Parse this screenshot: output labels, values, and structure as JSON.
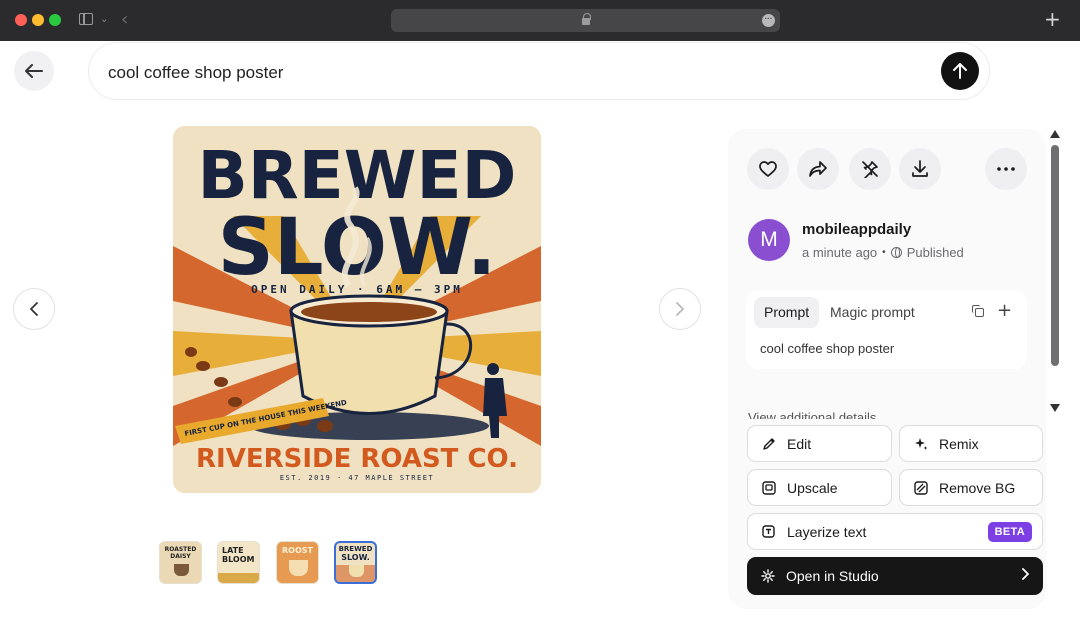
{
  "browser": {
    "icons": [
      "sidebar-icon",
      "chevron-down-icon",
      "back-icon",
      "lock-icon",
      "more-icon",
      "new-tab-icon"
    ]
  },
  "search": {
    "query": "cool coffee shop poster"
  },
  "poster": {
    "headline_1": "BREWED",
    "headline_2": "SLOW.",
    "hours": "OPEN DAILY · 6AM — 3PM",
    "banner": "FIRST CUP ON THE HOUSE THIS WEEKEND",
    "brand": "RIVERSIDE ROAST CO.",
    "footer": "EST. 2019 · 47 MAPLE STREET",
    "colors": {
      "navy": "#17233f",
      "orange": "#d25a1e",
      "cream": "#efe1c2",
      "gold": "#e8a92c"
    }
  },
  "thumbnails": [
    {
      "label_1": "ROASTED",
      "label_2": "DAISY",
      "active": false
    },
    {
      "label_1": "LATE",
      "label_2": "BLOOM",
      "active": false
    },
    {
      "label_1": "ROOST",
      "label_2": "",
      "active": false
    },
    {
      "label_1": "BREWED",
      "label_2": "SLOW.",
      "active": true
    }
  ],
  "actions_top": [
    "heart-icon",
    "share-icon",
    "unpin-icon",
    "download-icon",
    "more-icon"
  ],
  "author": {
    "initial": "M",
    "name": "mobileappdaily",
    "time": "a minute ago",
    "separator": "•",
    "visibility": "Published",
    "avatar_color": "#8a4fd1"
  },
  "prompt_card": {
    "tab_prompt": "Prompt",
    "tab_magic": "Magic prompt",
    "text": "cool coffee shop poster"
  },
  "details_label": "View additional details",
  "buttons": {
    "edit": "Edit",
    "remix": "Remix",
    "upscale": "Upscale",
    "remove_bg": "Remove BG",
    "layerize": "Layerize text",
    "beta": "BETA",
    "studio": "Open in Studio"
  },
  "accent": {
    "beta": "#7b3fe4",
    "active_thumb": "#3b6fd8"
  }
}
